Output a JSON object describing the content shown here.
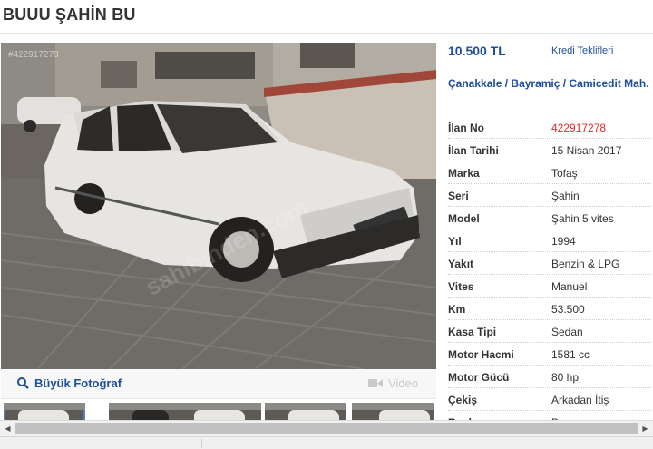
{
  "listing": {
    "title": "BUUU ŞAHİN BU",
    "photo_id": "#422917278",
    "watermark": "sahibinden.com",
    "big_photo_label": "Büyük Fotoğraf",
    "video_label": "Video"
  },
  "price": {
    "amount": "10.500 TL",
    "credit_link": "Kredi Teklifleri"
  },
  "location": {
    "city": "Çanakkale",
    "district": "Bayramiç",
    "neighborhood": "Camicedit Mah.",
    "separator": "/"
  },
  "details": [
    {
      "key": "İlan No",
      "value": "422917278"
    },
    {
      "key": "İlan Tarihi",
      "value": "15 Nisan 2017"
    },
    {
      "key": "Marka",
      "value": "Tofaş"
    },
    {
      "key": "Seri",
      "value": "Şahin"
    },
    {
      "key": "Model",
      "value": "Şahin 5 vites"
    },
    {
      "key": "Yıl",
      "value": "1994"
    },
    {
      "key": "Yakıt",
      "value": "Benzin & LPG"
    },
    {
      "key": "Vites",
      "value": "Manuel"
    },
    {
      "key": "Km",
      "value": "53.500"
    },
    {
      "key": "Kasa Tipi",
      "value": "Sedan"
    },
    {
      "key": "Motor Hacmi",
      "value": "1581 cc"
    },
    {
      "key": "Motor Gücü",
      "value": "80 hp"
    },
    {
      "key": "Çekiş",
      "value": "Arkadan İtiş"
    },
    {
      "key": "Renk",
      "value": "Beyaz"
    }
  ],
  "colors": {
    "link_blue": "#1f4e9c",
    "id_red": "#e02a2a"
  },
  "icons": {
    "search": "magnifier-icon",
    "video": "video-camera-icon"
  }
}
